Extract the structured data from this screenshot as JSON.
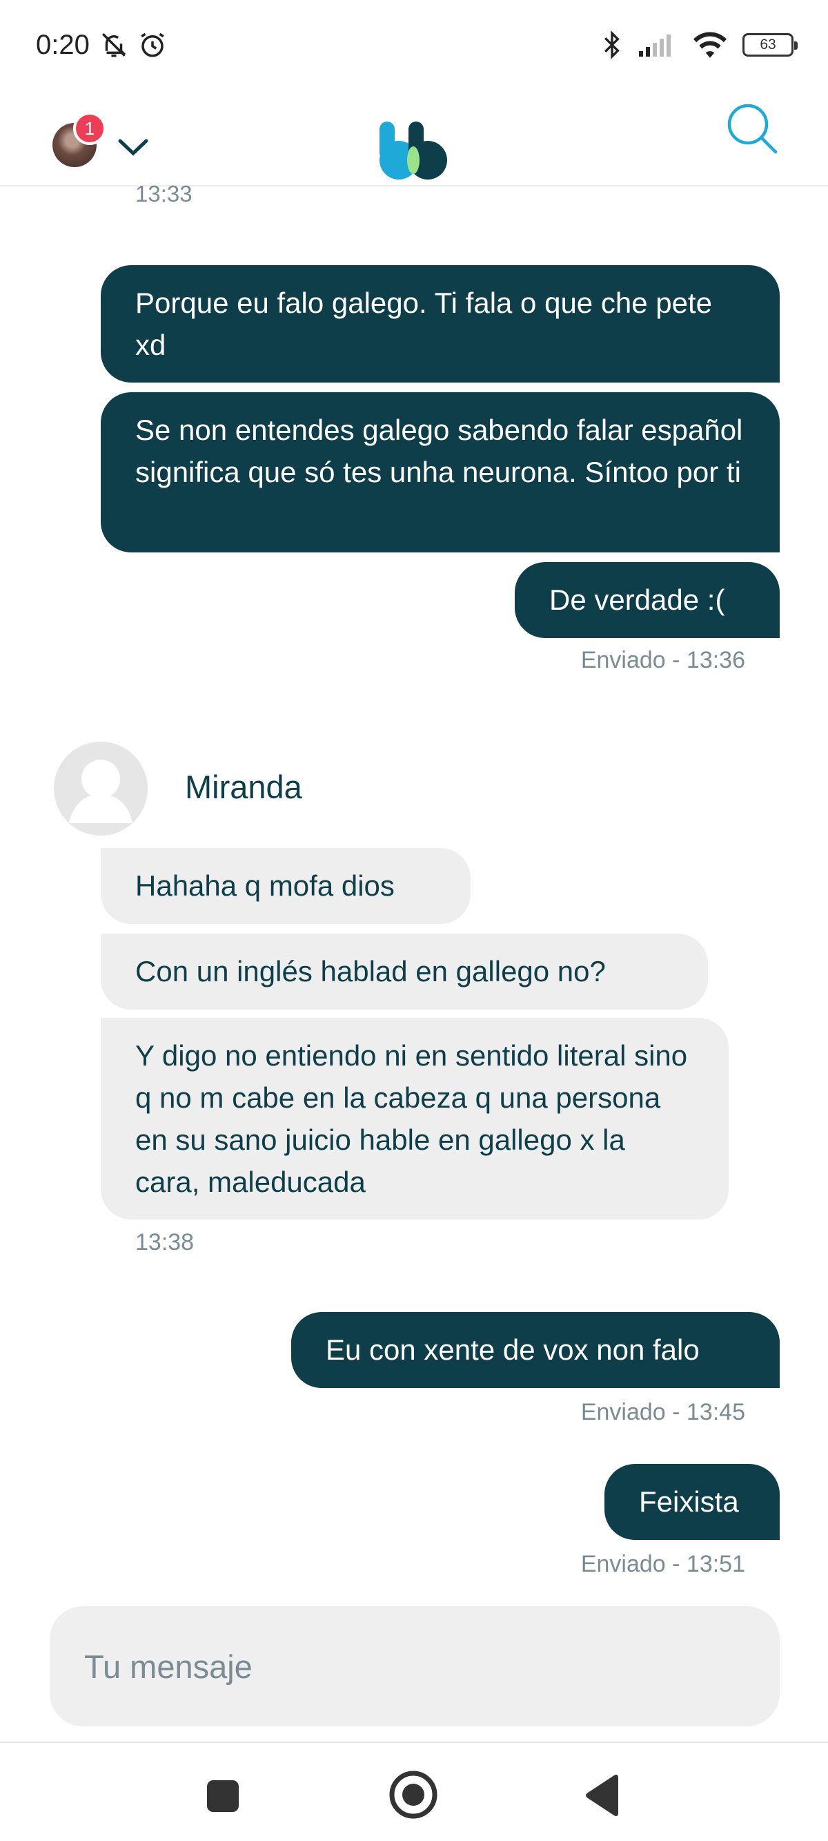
{
  "status_bar": {
    "time": "0:20",
    "battery": "63"
  },
  "header": {
    "notification_count": "1"
  },
  "messages": {
    "top_timestamp": "13:33",
    "out_1": "Porque eu falo galego. Ti fala o que che pete xd",
    "out_2": "Se non entendes galego sabendo falar español significa que só tes unha neurona. Síntoo por ti",
    "out_3": "De verdade :(",
    "meta_1": "Enviado - 13:36",
    "sender_name": "Miranda",
    "in_1": "Hahaha q mofa dios",
    "in_2": "Con un inglés hablad en gallego no?",
    "in_3": "Y digo no entiendo ni en sentido literal sino q no m cabe en la cabeza q una persona en su sano juicio hable en gallego x la cara, maleducada",
    "in_time": "13:38",
    "out_4": "Eu con xente de vox non falo",
    "meta_2": "Enviado - 13:45",
    "out_5": "Feixista",
    "meta_3": "Enviado - 13:51"
  },
  "composer": {
    "placeholder": "Tu mensaje",
    "value": ""
  },
  "colors": {
    "bubble_out": "#0d3e4a",
    "bubble_in": "#eeeeee",
    "accent_blue": "#1fa9d9",
    "accent_green": "#9be38a",
    "badge": "#ee3e57"
  }
}
